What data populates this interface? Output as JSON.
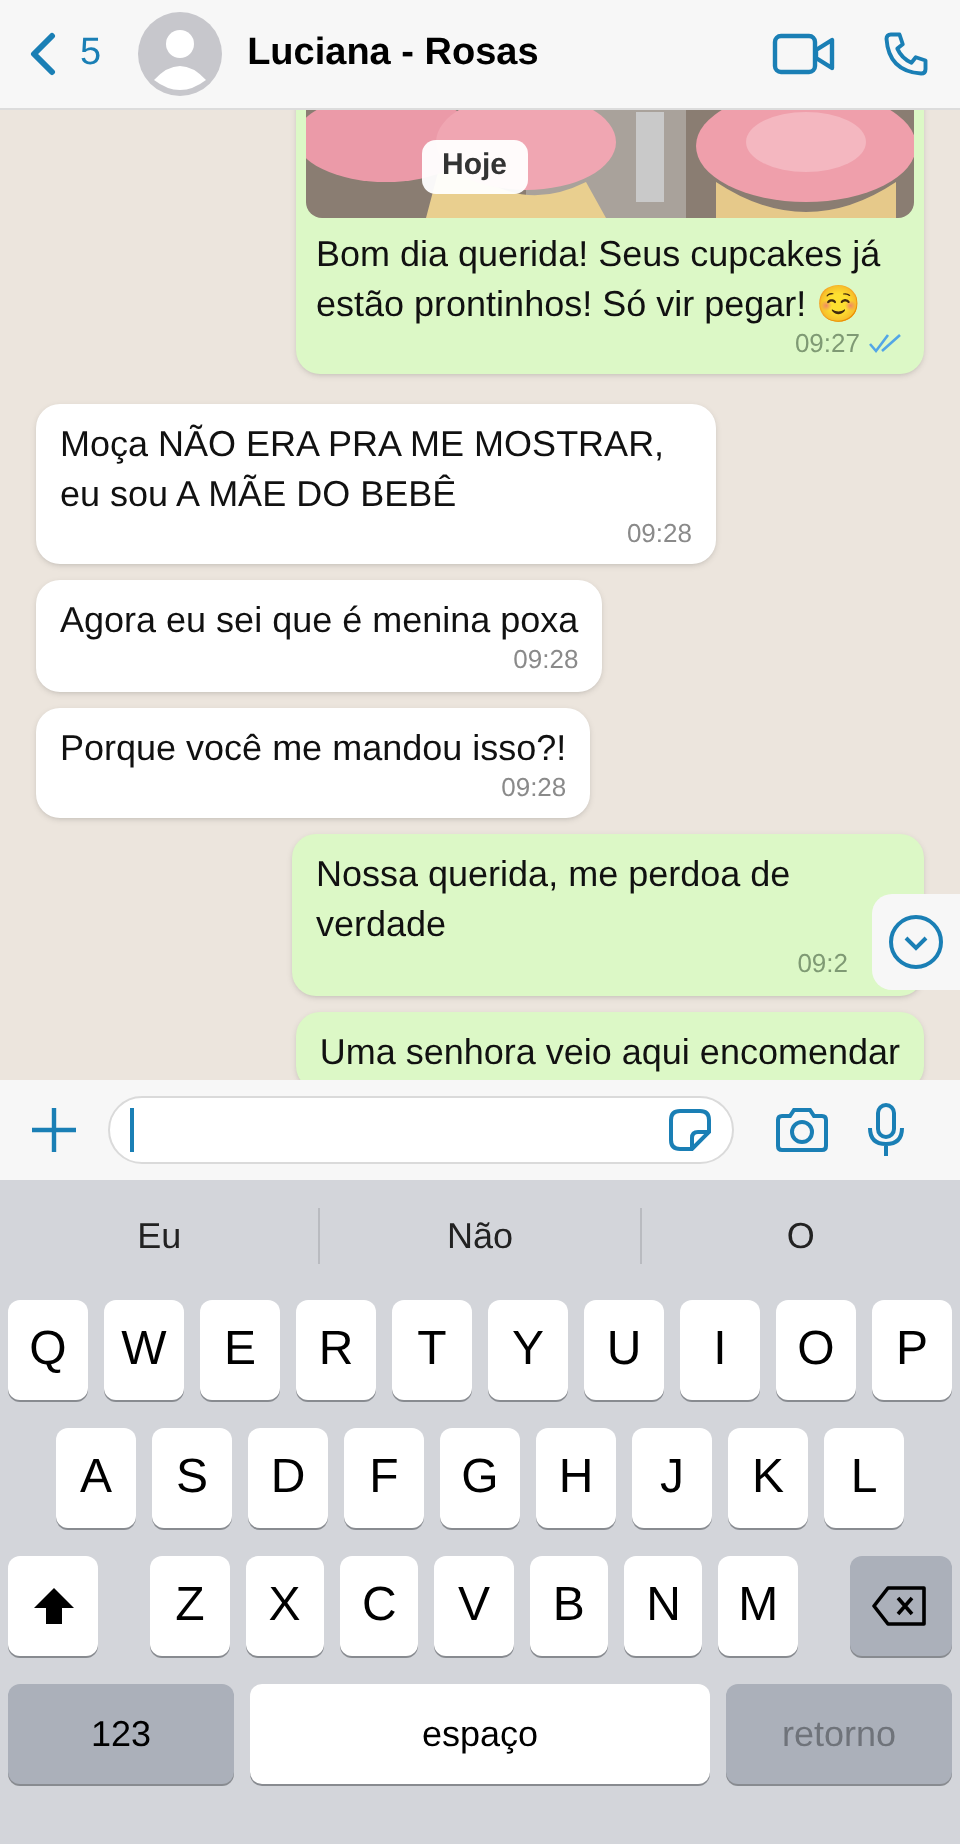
{
  "header": {
    "back_count": "5",
    "contact_name": "Luciana - Rosas"
  },
  "date_chip": "Hoje",
  "messages": [
    {
      "outgoing": true,
      "text": "Bom dia querida! Seus cupcakes já estão prontinhos! Só vir pegar! ☺️",
      "time": "09:27",
      "read": true
    },
    {
      "outgoing": false,
      "kind": "text",
      "text": "Moça NÃO ERA PRA ME MOSTRAR, eu sou A MÃE DO BEBÊ",
      "time": "09:28"
    },
    {
      "outgoing": false,
      "kind": "text",
      "text": "Agora eu sei que é menina poxa",
      "time": "09:28"
    },
    {
      "outgoing": false,
      "kind": "text",
      "text": "Porque você me mandou isso?!",
      "time": "09:28"
    },
    {
      "outgoing": true,
      "kind": "text",
      "text": "Nossa querida, me perdoa de verdade",
      "time": "09:2"
    },
    {
      "outgoing": true,
      "kind": "text",
      "text": "Uma senhora veio aqui encomendar"
    }
  ],
  "keyboard": {
    "suggestions": [
      "Eu",
      "Não",
      "O"
    ],
    "letter_rows": [
      [
        "Q",
        "W",
        "E",
        "R",
        "T",
        "Y",
        "U",
        "I",
        "O",
        "P"
      ],
      [
        "A",
        "S",
        "D",
        "F",
        "G",
        "H",
        "J",
        "K",
        "L"
      ],
      [
        "Z",
        "X",
        "C",
        "V",
        "B",
        "N",
        "M"
      ]
    ],
    "numbers_key": "123",
    "space_key": "espaço",
    "return_key": {
      "label": "retorno",
      "disabled": true
    }
  }
}
